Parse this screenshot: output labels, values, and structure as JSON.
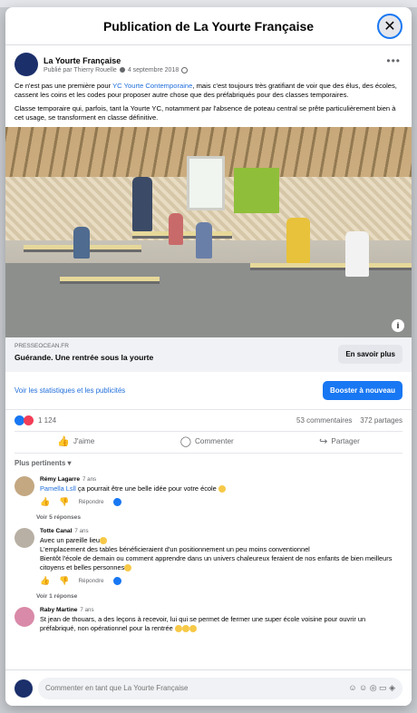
{
  "modal": {
    "title": "Publication de La Yourte Française",
    "close_glyph": "✕"
  },
  "post": {
    "page_name": "La Yourte Française",
    "published_by": "Publié par Thierry Rouelle",
    "date": "4 septembre 2018",
    "more_glyph": "•••",
    "text_p1_before": "Ce n'est pas une première pour ",
    "text_p1_mention": "YC Yourte Contemporaine",
    "text_p1_after": ", mais c'est toujours très gratifiant de voir que des élus, des écoles, cassent les coins et les codes pour proposer autre chose que des préfabriqués pour des classes temporaires.",
    "text_p2": "Classe temporaire qui, parfois, tant la Yourte YC, notamment par l'absence de poteau central se prête particulièrement bien à cet usage, se transforment en classe définitive.",
    "photo_info_glyph": "i"
  },
  "link_card": {
    "domain": "PRESSEOCEAN.FR",
    "title": "Guérande. Une rentrée sous la yourte",
    "button": "En savoir plus"
  },
  "insights": {
    "stats_link": "Voir les statistiques et les publicités",
    "boost_button": "Booster à nouveau"
  },
  "reactions": {
    "count": "1 124",
    "comments": "53 commentaires",
    "shares": "372 partages"
  },
  "actions": {
    "like": "J'aime",
    "like_glyph": "👍",
    "comment": "Commenter",
    "comment_glyph": "◯",
    "share": "Partager",
    "share_glyph": "↪"
  },
  "sort_label": "Plus pertinents ▾",
  "comments": [
    {
      "author": "Rémy Lagarre",
      "time": "7 ans",
      "mention": "Pamella Lsll",
      "text": " ça pourrait être une belle idée pour votre école ",
      "reply_label": "Répondre",
      "replies": "Voir 5 réponses"
    },
    {
      "author": "Totte Canal",
      "time": "7 ans",
      "line1": "Avec un pareille lieu",
      "line2": "L'emplacement des tables bénéficieraient d'un positionnement un peu moins conventionnel",
      "line3": "Bientôt l'école de demain ou comment apprendre dans un univers chaleureux feraient de nos enfants de bien meilleurs citoyens et belles personnes",
      "reply_label": "Répondre",
      "replies": "Voir 1 réponse"
    },
    {
      "author": "Raby Martine",
      "time": "7 ans",
      "text": "St jean de thouars, a des leçons à recevoir, lui qui se permet de fermer une super école voisine pour ouvrir un préfabriqué, non opérationnel pour la rentrée"
    }
  ],
  "compose": {
    "placeholder": "Commenter en tant que La Yourte Française",
    "icons": "☺ ☺ ◎ ▭ ◈"
  },
  "colors": {
    "accent": "#1877f2",
    "link": "#216fdb",
    "love": "#f33e58"
  }
}
